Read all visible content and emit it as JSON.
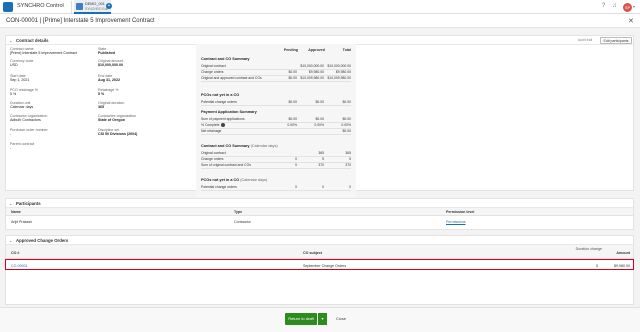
{
  "app": {
    "name": "SYNCHRO Control",
    "project_name": "DEMO_001",
    "project_sub": "SYNCHRO Edit",
    "avatar": "SP"
  },
  "page": {
    "title": "CON-00001 | [Prime] Interstate 5 Improvement Contract"
  },
  "contract_details": {
    "header": "Contract details",
    "audit_trail": "Audit trail",
    "edit_participants": "Edit participants",
    "fields_left": [
      {
        "label": "Contract name",
        "value": "[Prime] Interstate 5 Improvement Contract"
      },
      {
        "label": "Currency code",
        "value": "USD"
      },
      {
        "label": "Start date",
        "value": "Sep 1, 2021"
      },
      {
        "label": "PCO retainage %",
        "value": "5 %"
      },
      {
        "label": "Duration unit",
        "value": "Calendar days"
      },
      {
        "label": "Contractor organization",
        "value": "Adbulh Contractors"
      },
      {
        "label": "Purchase order number",
        "value": "-"
      },
      {
        "label": "Parent contract",
        "value": "-"
      }
    ],
    "fields_right": [
      {
        "label": "State",
        "value": "Published"
      },
      {
        "label": "Original amount",
        "value": "$10,000,000.00"
      },
      {
        "label": "End date",
        "value": "Aug 31, 2022"
      },
      {
        "label": "Retainage %",
        "value": "5 %"
      },
      {
        "label": "Original duration",
        "value": "365"
      },
      {
        "label": "Contractee organization",
        "value": "State of Oregon"
      },
      {
        "label": "Discipline set",
        "value": "CSI 50 Divisions (2004)"
      }
    ]
  },
  "summary": {
    "columns": [
      "Pending",
      "Approved",
      "Total"
    ],
    "sections": [
      {
        "title": "Contract and CO Summary",
        "rows": [
          {
            "label": "Original contract",
            "values": [
              "",
              "$10,000,000.00",
              "$10,000,000.00"
            ]
          },
          {
            "label": "Change orders",
            "values": [
              "$0.00",
              "$9,980.00",
              "$9,980.00"
            ]
          },
          {
            "label": "Original and approved contract and COs",
            "values": [
              "$0.00",
              "$10,009,980.00",
              "$10,009,980.00"
            ]
          }
        ]
      },
      {
        "title": "PCOs not yet in a CO",
        "rows": [
          {
            "label": "Potential change orders",
            "values": [
              "$0.00",
              "$0.00",
              "$0.00"
            ]
          }
        ]
      },
      {
        "title": "Payment Application Summary",
        "rows": [
          {
            "label": "Sum of payment applications",
            "values": [
              "$0.00",
              "$0.00",
              "$0.00"
            ]
          },
          {
            "label": "% Complete",
            "values": [
              "0.00%",
              "0.00%",
              "0.00%"
            ]
          },
          {
            "label": "Net retainage",
            "values": [
              "",
              "",
              "$0.00"
            ]
          }
        ]
      },
      {
        "title": "Contract and CO Summary",
        "subtitle": "(Calendar days)",
        "rows": [
          {
            "label": "Original contract",
            "values": [
              "",
              "365",
              "365"
            ]
          },
          {
            "label": "Change orders",
            "values": [
              "0",
              "5",
              "5"
            ]
          },
          {
            "label": "Sum of original contract and COs",
            "values": [
              "0",
              "370",
              "370"
            ]
          }
        ]
      },
      {
        "title": "PCOs not yet in a CO",
        "subtitle": "(Calendar days)",
        "rows": [
          {
            "label": "Potential change orders",
            "values": [
              "0",
              "0",
              "0"
            ]
          }
        ]
      }
    ]
  },
  "participants": {
    "header": "Participants",
    "columns": [
      "Name",
      "Type",
      "Permission level"
    ],
    "rows": [
      {
        "name": "Arijit Prakash",
        "type": "Contractor",
        "permission": "Permissions"
      }
    ]
  },
  "approved_cos": {
    "header": "Approved Change Orders",
    "columns": [
      "CO #",
      "CO subject",
      "Duration change",
      "Amount"
    ],
    "rows": [
      {
        "co": "CO-00001",
        "subject": "September Change Orders",
        "duration": "5",
        "amount": "$9,980.00"
      }
    ]
  },
  "footer": {
    "return": "Return to draft",
    "close": "Close"
  },
  "colors": {
    "accent": "#1a6fb4",
    "green": "#2e8b1f",
    "highlight": "#d9001b"
  }
}
